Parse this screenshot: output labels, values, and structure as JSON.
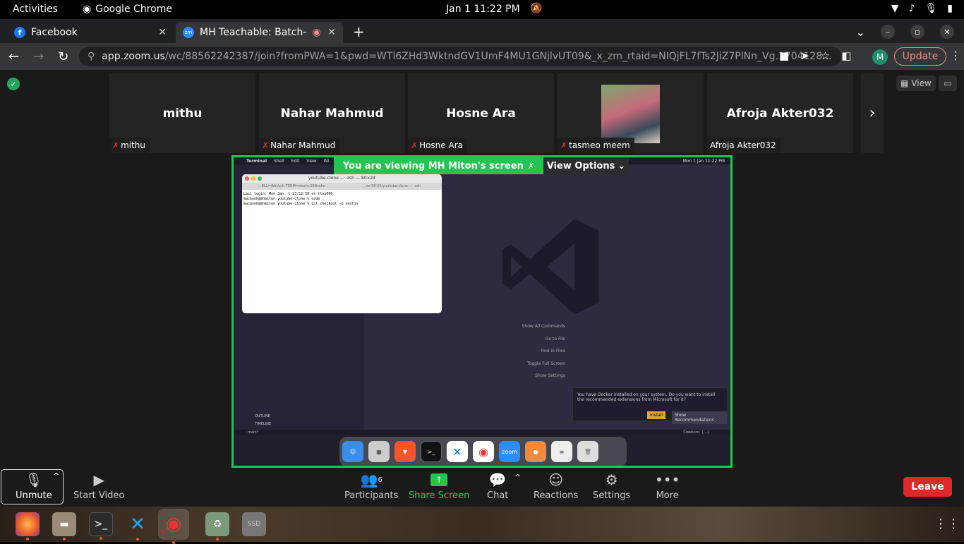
{
  "gnome": {
    "activities": "Activities",
    "app": "Google Chrome",
    "clock": "Jan 1  11:22 PM"
  },
  "tabs": [
    {
      "title": "Facebook"
    },
    {
      "title": "MH Teachable: Batch-"
    }
  ],
  "address": {
    "host": "app.zoom.us",
    "path": "/wc/88562242387/join?fromPWA=1&pwd=WTl6ZHd3WktndGV1UmF4MU1GNjlvUT09&_x_zm_rtaid=NIQjFL7fTs2JiZ7PlNn_Vg.1704128...",
    "avatar": "M",
    "update": "Update"
  },
  "participants": [
    {
      "name": "mithu",
      "label": "mithu",
      "muted": true
    },
    {
      "name": "Nahar Mahmud",
      "label": "Nahar Mahmud",
      "muted": true
    },
    {
      "name": "Hosne Ara",
      "label": "Hosne Ara",
      "muted": true
    },
    {
      "name": "",
      "label": "tasmeo meem",
      "muted": true
    },
    {
      "name": "Afroja Akter032",
      "label": "Afroja Akter032",
      "muted": false
    }
  ],
  "view": {
    "label": "View"
  },
  "share": {
    "banner": "You are viewing  MH Miton's screen",
    "view_options": "View Options"
  },
  "mac": {
    "app": "Terminal",
    "menus": [
      "Shell",
      "Edit",
      "View",
      "Wi"
    ],
    "clock": "Mon 1 Jan  11:22 PM"
  },
  "terminal": {
    "title": "youtube-clone — -zsh — 80×24",
    "tab1": "...ELL=/bin/zsh TERM=xterm-256color",
    "tab2": "...ss-18-25/youtube-clone — -zsh",
    "lines": "Last login: Mon Jan  1 23:12:56 on ttys000\nmacbook@mhmiton youtube-clone % code .\nmacbook@mhmiton youtube-clone % git checkout -b nextjs"
  },
  "vscode": {
    "commands": [
      "Show All Commands",
      "Go to File",
      "Find in Files",
      "Toggle Full Screen",
      "Show Settings"
    ],
    "notification": "You have Docker installed on your system. Do you want to install the recommended extensions from Microsoft for it?",
    "install": "Install",
    "recommend": "Show Recommendations",
    "outline": "OUTLINE",
    "timeline": "TIMELINE",
    "status": "main*",
    "codeium": "Codeium: {...}"
  },
  "toolbar": {
    "unmute": "Unmute",
    "video": "Start Video",
    "participants": "Participants",
    "count": "6",
    "share": "Share Screen",
    "chat": "Chat",
    "reactions": "Reactions",
    "settings": "Settings",
    "more": "More",
    "leave": "Leave"
  },
  "dock_icons": [
    "finder",
    "launchpad",
    "brave",
    "terminal",
    "vscode",
    "chrome",
    "zoom",
    "recorder",
    "preview",
    "trash"
  ],
  "ubuntu_dock": [
    "firefox-icon",
    "files-icon",
    "terminal-icon",
    "vscode-icon",
    "chrome-icon",
    "trash-icon",
    "ssd-icon"
  ]
}
